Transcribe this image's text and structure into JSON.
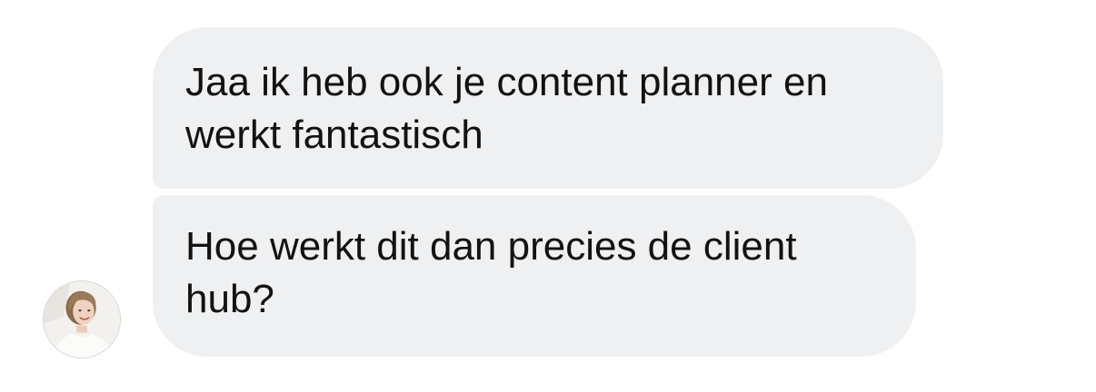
{
  "messages": [
    {
      "lines": [
        "Jaa ik heb ook je content planner en",
        "werkt fantastisch"
      ]
    },
    {
      "lines": [
        "Hoe werkt dit dan precies de client",
        "hub?"
      ]
    }
  ],
  "avatar": {
    "icon": "profile-photo-icon"
  },
  "colors": {
    "bubble_background": "#eff0f2",
    "text": "#121212",
    "page_background": "#ffffff"
  }
}
